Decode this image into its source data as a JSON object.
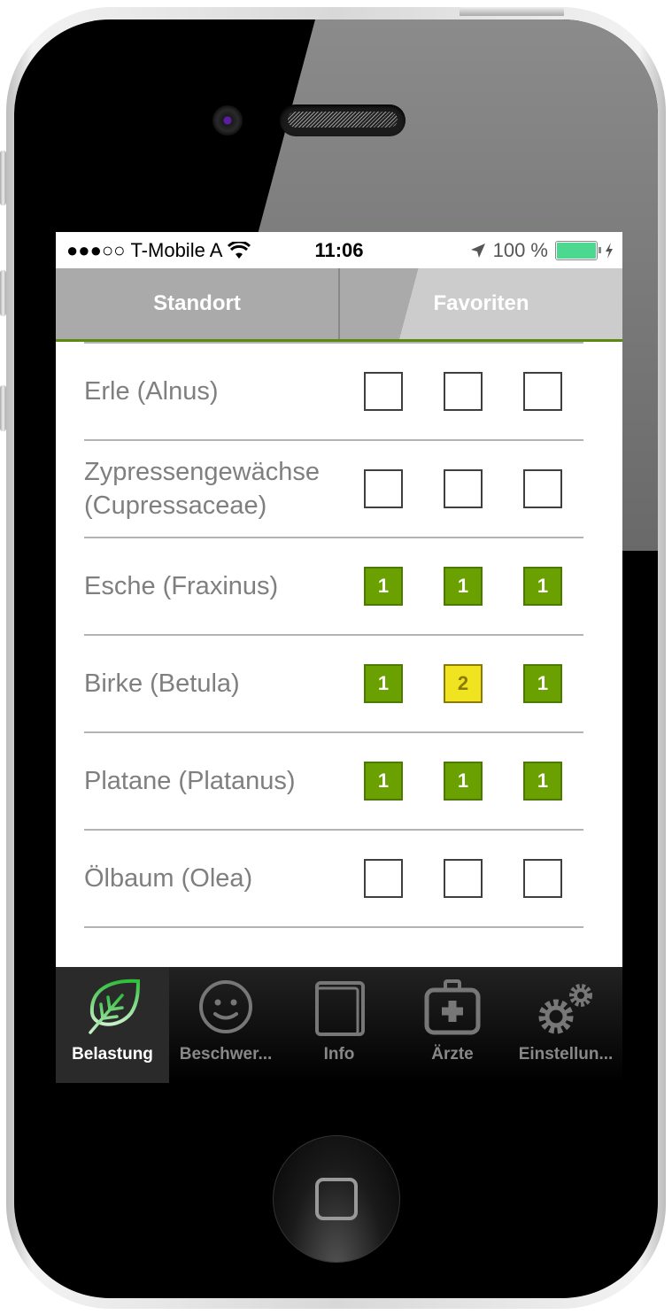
{
  "status_bar": {
    "signal": "●●●○○",
    "carrier": "T-Mobile A",
    "time": "11:06",
    "battery_percent": "100 %",
    "battery_level": 1.0
  },
  "segments": [
    {
      "label": "Standort",
      "selected": false
    },
    {
      "label": "Favoriten",
      "selected": false
    }
  ],
  "colors": {
    "level1": "#6aa000",
    "level2": "#f0e420",
    "accent": "#5a8a10"
  },
  "pollen_rows": [
    {
      "name": "Erle (Alnus)",
      "levels": [
        "",
        "",
        ""
      ]
    },
    {
      "name": "Zypressengewächse (Cupressaceae)",
      "levels": [
        "",
        "",
        ""
      ]
    },
    {
      "name": "Esche (Fraxinus)",
      "levels": [
        "1",
        "1",
        "1"
      ]
    },
    {
      "name": "Birke (Betula)",
      "levels": [
        "1",
        "2",
        "1"
      ]
    },
    {
      "name": "Platane (Platanus)",
      "levels": [
        "1",
        "1",
        "1"
      ]
    },
    {
      "name": "Ölbaum (Olea)",
      "levels": [
        "",
        "",
        ""
      ]
    }
  ],
  "tabbar": [
    {
      "label": "Belastung",
      "icon": "leaf-icon",
      "active": true
    },
    {
      "label": "Beschwer...",
      "icon": "smiley-icon",
      "active": false
    },
    {
      "label": "Info",
      "icon": "book-icon",
      "active": false
    },
    {
      "label": "Ärzte",
      "icon": "medical-kit-icon",
      "active": false
    },
    {
      "label": "Einstellun...",
      "icon": "gears-icon",
      "active": false
    }
  ]
}
